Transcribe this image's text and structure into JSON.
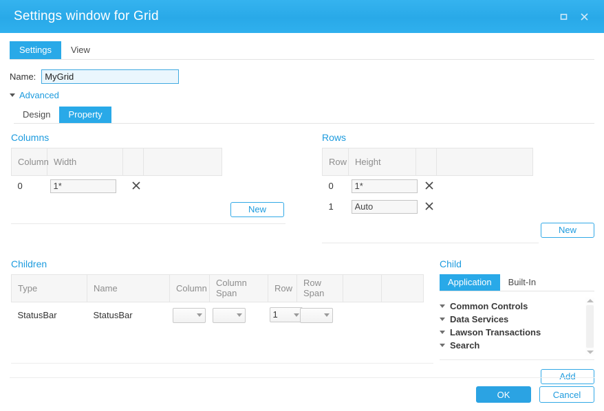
{
  "window": {
    "title": "Settings window for Grid",
    "controls": [
      {
        "name": "maximize-button",
        "icon": "square-icon"
      },
      {
        "name": "close-button",
        "icon": "close-icon"
      }
    ]
  },
  "main_tabs": [
    {
      "label": "Settings",
      "active": true
    },
    {
      "label": "View",
      "active": false
    }
  ],
  "name_field": {
    "label": "Name:",
    "value": "MyGrid",
    "placeholder": ""
  },
  "advanced": {
    "label": "Advanced",
    "expanded": true,
    "toggle_icon": "triangle-down-icon"
  },
  "sub_tabs": [
    {
      "label": "Design",
      "active": false
    },
    {
      "label": "Property",
      "active": true
    }
  ],
  "columns": {
    "title": "Columns",
    "headers": [
      "Column",
      "Width",
      "",
      ""
    ],
    "rows": [
      {
        "index": "0",
        "width": "1*",
        "delete_icon": "close-icon"
      }
    ],
    "new_label": "New"
  },
  "rows": {
    "title": "Rows",
    "headers": [
      "Row",
      "Height",
      "",
      ""
    ],
    "rows": [
      {
        "index": "0",
        "height": "1*",
        "delete_icon": "close-icon"
      },
      {
        "index": "1",
        "height": "Auto",
        "delete_icon": "close-icon"
      }
    ],
    "new_label": "New"
  },
  "children": {
    "title": "Children",
    "headers": [
      "Type",
      "Name",
      "Column",
      "Column Span",
      "Row",
      "Row Span",
      "",
      ""
    ],
    "rows": [
      {
        "type": "StatusBar",
        "name": "StatusBar",
        "column": "",
        "column_span": "",
        "row": "1",
        "row_span": ""
      }
    ]
  },
  "child": {
    "title": "Child",
    "tabs": [
      {
        "label": "Application",
        "active": true
      },
      {
        "label": "Built-In",
        "active": false
      }
    ],
    "tree": [
      {
        "label": "Common Controls",
        "toggle_icon": "triangle-down-icon"
      },
      {
        "label": "Data Services",
        "toggle_icon": "triangle-down-icon"
      },
      {
        "label": "Lawson Transactions",
        "toggle_icon": "triangle-down-icon"
      },
      {
        "label": "Search",
        "toggle_icon": "triangle-down-icon"
      }
    ],
    "scrollbar": {
      "up_icon": "scroll-up-arrow-icon",
      "down_icon": "scroll-down-arrow-icon"
    },
    "add_label": "Add"
  },
  "footer": {
    "ok_label": "OK",
    "cancel_label": "Cancel"
  },
  "colors": {
    "accent": "#29a9e8",
    "link": "#1d9bde",
    "header_bg": "#f6f6f6",
    "input_focus_bg": "#eaf6fd"
  }
}
